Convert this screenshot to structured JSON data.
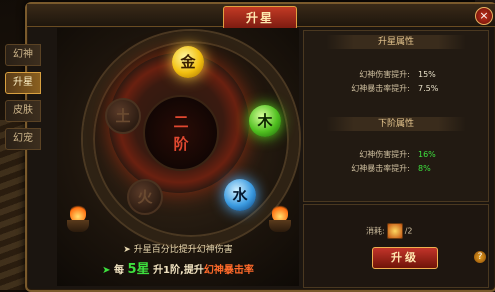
{
  "window": {
    "title": "升星",
    "close_label": "×"
  },
  "tabs": [
    {
      "label": "幻神",
      "active": false
    },
    {
      "label": "升星",
      "active": true
    },
    {
      "label": "皮肤",
      "active": false
    },
    {
      "label": "幻宠",
      "active": false
    }
  ],
  "wheel": {
    "center_text": "二\n阶",
    "elements": [
      {
        "label": "金",
        "lit": true,
        "color": "#f2c010"
      },
      {
        "label": "木",
        "lit": true,
        "color": "#50c020"
      },
      {
        "label": "水",
        "lit": true,
        "color": "#3a9ae0"
      },
      {
        "label": "火",
        "lit": false
      },
      {
        "label": "土",
        "lit": false
      }
    ]
  },
  "info": {
    "line1": "升星百分比提升幻神伤害",
    "line2": {
      "prefix": "每",
      "num": "5星",
      "mid": "升1阶,提升",
      "highlight": "幻神暴击率"
    }
  },
  "attributes": {
    "current": {
      "title": "升星属性",
      "rows": [
        {
          "label": "幻神伤害提升:",
          "value": "15%"
        },
        {
          "label": "幻神暴击率提升:",
          "value": "7.5%"
        }
      ]
    },
    "next": {
      "title": "下阶属性",
      "rows": [
        {
          "label": "幻神伤害提升:",
          "value": "16%"
        },
        {
          "label": "幻神暴击率提升:",
          "value": "8%"
        }
      ]
    }
  },
  "cost": {
    "label": "消耗:",
    "value": "/2"
  },
  "upgrade": {
    "label": "升级"
  },
  "help": {
    "label": "?"
  }
}
